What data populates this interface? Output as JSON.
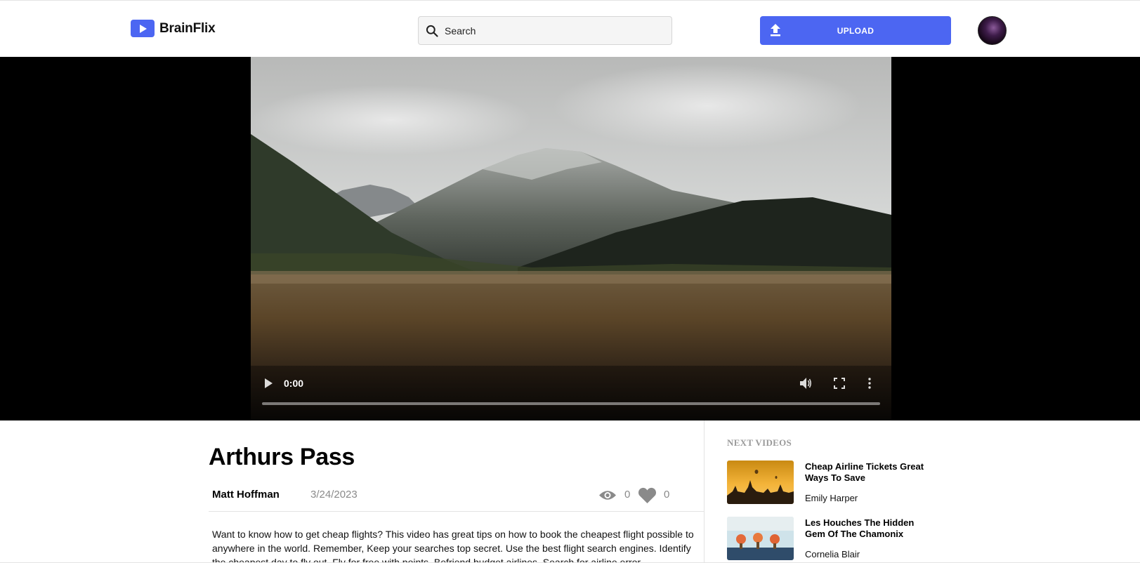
{
  "header": {
    "logo_text": "BrainFlix",
    "search_placeholder": "Search",
    "upload_label": "UPLOAD"
  },
  "video": {
    "current_time": "0:00",
    "progress_percent": 0
  },
  "details": {
    "title": "Arthurs Pass",
    "author": "Matt Hoffman",
    "date": "3/24/2023",
    "views": "0",
    "likes": "0",
    "description": "Want to know how to get cheap flights? This video has great tips on how to book the cheapest flight possible to anywhere in the world. Remember, Keep your searches top secret. Use the best flight search engines. Identify the cheapest day to fly out. Fly for free with points. Befriend budget airlines. Search for airline error"
  },
  "next_videos": {
    "heading": "NEXT VIDEOS",
    "items": [
      {
        "title": "Cheap Airline Tickets Great Ways To Save",
        "author": "Emily Harper"
      },
      {
        "title": "Les Houches The Hidden Gem Of The Chamonix",
        "author": "Cornelia Blair"
      }
    ]
  },
  "colors": {
    "brand": "#4c66f2",
    "muted_text": "#8a8a8a",
    "divider": "#e3e3e3"
  },
  "icons": {
    "logo": "play-icon",
    "search": "search-icon",
    "upload": "upload-icon",
    "views": "eye-icon",
    "likes": "heart-icon",
    "player": [
      "play-icon",
      "volume-icon",
      "fullscreen-icon",
      "more-vertical-icon"
    ]
  }
}
